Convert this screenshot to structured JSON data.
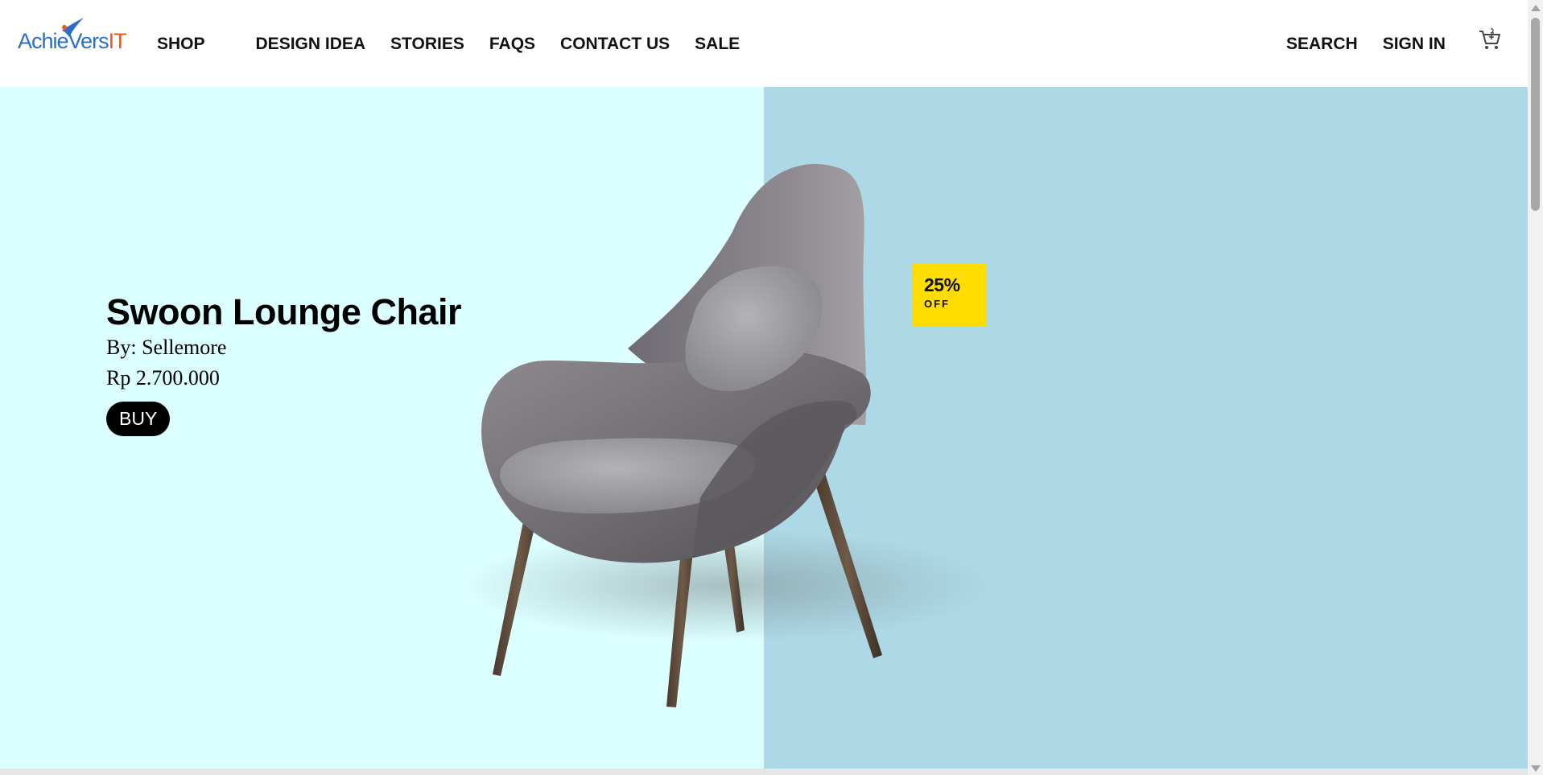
{
  "header": {
    "logo": {
      "text_main": "AchieVers",
      "text_accent": "IT"
    },
    "nav": [
      {
        "label": "SHOP"
      },
      {
        "label": "DESIGN IDEA"
      },
      {
        "label": "STORIES"
      },
      {
        "label": "FAQS"
      },
      {
        "label": "CONTACT US"
      },
      {
        "label": "SALE"
      }
    ],
    "right": {
      "search_label": "SEARCH",
      "signin_label": "SIGN IN",
      "cart_icon": "shopping-cart-icon"
    }
  },
  "hero": {
    "title": "Swoon Lounge Chair",
    "by": "By: Sellemore",
    "price": "Rp 2.700.000",
    "buy_label": "BUY",
    "discount": {
      "percent": "25%",
      "off": "OFF"
    },
    "colors": {
      "left_bg": "#dcffff",
      "right_bg": "#add8e6",
      "badge": "#ffdd00",
      "button": "#000000"
    }
  }
}
